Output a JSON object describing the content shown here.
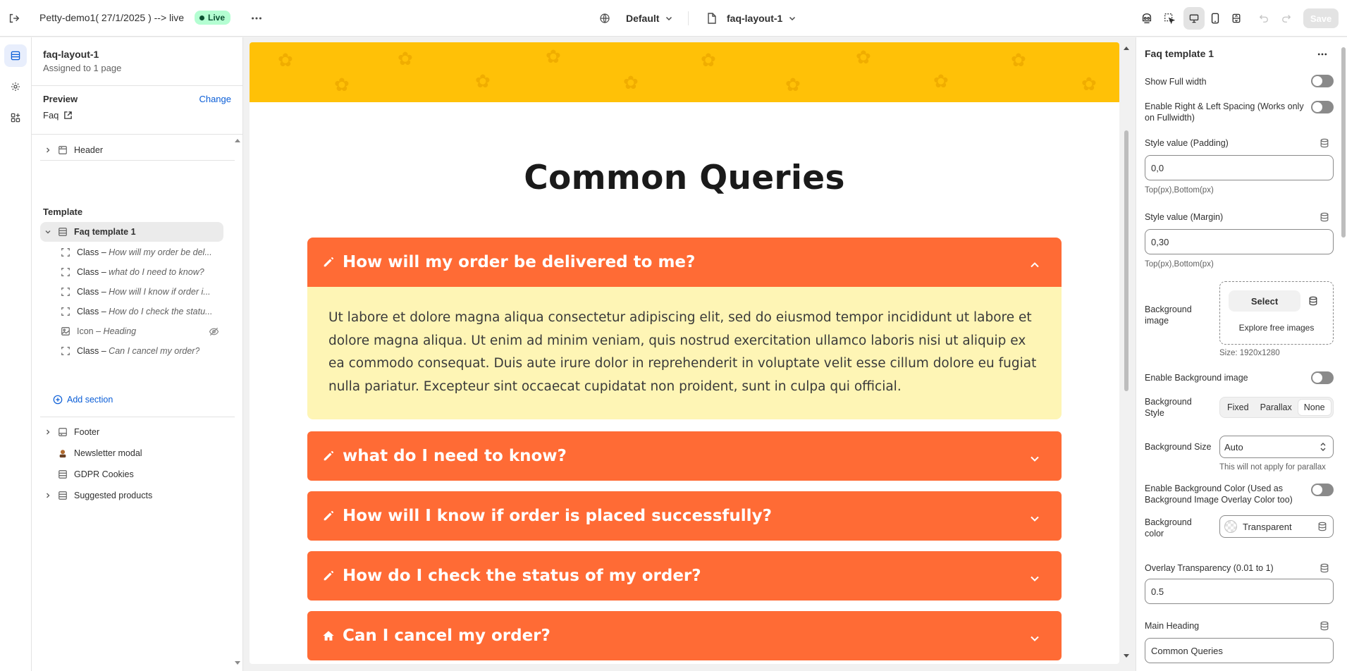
{
  "topbar": {
    "store_name": "Petty-demo1( 27/1/2025 ) --> live",
    "live_badge": "Live",
    "theme_selector": "Default",
    "template_selector": "faq-layout-1",
    "save_label": "Save",
    "icons": [
      "exit-icon",
      "more-icon",
      "globe-icon",
      "page-icon",
      "inspector-icon",
      "select-element-icon",
      "desktop-icon",
      "mobile-icon",
      "fullscreen-icon",
      "undo-icon",
      "redo-icon"
    ]
  },
  "sidebar": {
    "title": "faq-layout-1",
    "subtitle": "Assigned to 1 page",
    "preview_label": "Preview",
    "preview_change": "Change",
    "preview_page": "Faq",
    "header_section": "Header",
    "template_heading": "Template",
    "template_section": "Faq template 1",
    "blocks": [
      {
        "type": "Class",
        "name": "How will my order be del...",
        "icon": "block-icon"
      },
      {
        "type": "Class",
        "name": "what do I need to know?",
        "icon": "block-icon"
      },
      {
        "type": "Class",
        "name": "How will I know if order i...",
        "icon": "block-icon"
      },
      {
        "type": "Class",
        "name": "How do I check the statu...",
        "icon": "block-icon"
      },
      {
        "type": "Icon",
        "name": "Heading",
        "icon": "image-block-icon"
      },
      {
        "type": "Class",
        "name": "Can I cancel my order?",
        "icon": "block-icon"
      }
    ],
    "separator": " – ",
    "add_section": "Add section",
    "footer_sections": [
      "Footer",
      "Newsletter modal",
      "GDPR Cookies",
      "Suggested products"
    ]
  },
  "preview": {
    "heading": "Common Queries",
    "accent_color": "#ff6b35",
    "banner_color": "#ffc107",
    "answer_bg": "#fef5b5",
    "faqs": [
      {
        "question": "How will my order be delivered to me?",
        "open": true,
        "icon": "pencil-icon",
        "answer": "Ut labore et dolore magna aliqua consectetur adipiscing elit, sed do eiusmod tempor incididunt ut labore et dolore magna aliqua. Ut enim ad minim veniam, quis nostrud exercitation ullamco laboris nisi ut aliquip ex ea commodo consequat. Duis aute irure dolor in reprehenderit in voluptate velit esse cillum dolore eu fugiat nulla pariatur. Excepteur sint occaecat cupidatat non proident, sunt in culpa qui official."
      },
      {
        "question": "what do I need to know?",
        "open": false,
        "icon": "pencil-icon"
      },
      {
        "question": "How will I know if order is placed successfully?",
        "open": false,
        "icon": "pencil-icon"
      },
      {
        "question": "How do I check the status of my order?",
        "open": false,
        "icon": "pencil-icon"
      },
      {
        "question": "Can I cancel my order?",
        "open": false,
        "icon": "home-icon"
      }
    ]
  },
  "settings": {
    "title": "Faq template 1",
    "show_full_width": "Show Full width",
    "enable_spacing": "Enable Right & Left Spacing (Works only on Fullwidth)",
    "padding_label": "Style value (Padding)",
    "padding_value": "0,0",
    "padding_hint": "Top(px),Bottom(px)",
    "margin_label": "Style value (Margin)",
    "margin_value": "0,30",
    "margin_hint": "Top(px),Bottom(px)",
    "bg_image_label": "Background image",
    "bg_image_select": "Select",
    "bg_image_explore": "Explore free images",
    "bg_image_size": "Size: 1920x1280",
    "enable_bg_image": "Enable Background image",
    "bg_style_label": "Background Style",
    "bg_style_options": [
      "Fixed",
      "Parallax",
      "None"
    ],
    "bg_style_selected": "None",
    "bg_size_label": "Background Size",
    "bg_size_value": "Auto",
    "bg_size_hint": "This will not apply for parallax",
    "enable_bg_color": "Enable Background Color (Used as Background Image Overlay Color too)",
    "bg_color_label": "Background color",
    "bg_color_value": "Transparent",
    "overlay_label": "Overlay Transparency (0.01 to 1)",
    "overlay_value": "0.5",
    "main_heading_label": "Main Heading",
    "main_heading_value": "Common Queries"
  }
}
